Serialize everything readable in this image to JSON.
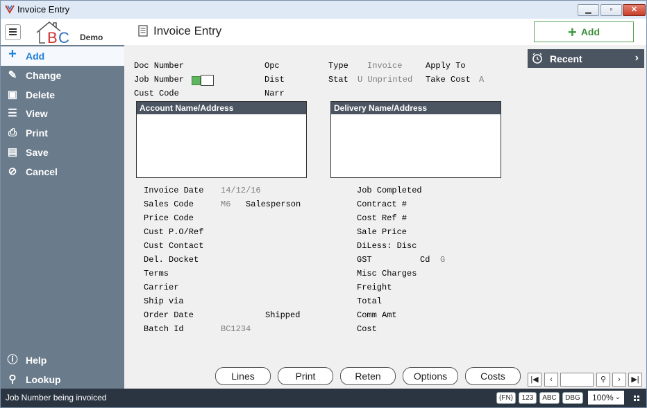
{
  "window": {
    "title": "Invoice Entry",
    "minimize_icon": "minimize-icon",
    "maximize_icon": "maximize-icon",
    "close_icon": "close-icon"
  },
  "header": {
    "logo_text": "BC",
    "logo_sub": "Demo",
    "page_title": "Invoice Entry",
    "add_label": "Add"
  },
  "sidebar": {
    "items": [
      {
        "label": "Add",
        "icon": "plus-icon"
      },
      {
        "label": "Change",
        "icon": "pencil-icon"
      },
      {
        "label": "Delete",
        "icon": "trash-icon"
      },
      {
        "label": "View",
        "icon": "list-icon"
      },
      {
        "label": "Print",
        "icon": "printer-icon"
      },
      {
        "label": "Save",
        "icon": "floppy-icon"
      },
      {
        "label": "Cancel",
        "icon": "cancel-icon"
      }
    ],
    "bottom_items": [
      {
        "label": "Help",
        "icon": "info-icon"
      },
      {
        "label": "Lookup",
        "icon": "search-icon"
      }
    ]
  },
  "recent": {
    "label": "Recent"
  },
  "form": {
    "doc_number": "Doc Number",
    "job_number": "Job Number",
    "cust_code": "Cust Code",
    "opc": "Opc",
    "dist": "Dist",
    "narr": "Narr",
    "type": "Type",
    "type_value": "Invoice",
    "stat": "Stat",
    "stat_value": "U Unprinted",
    "apply_to": "Apply To",
    "take_cost": "Take Cost",
    "take_cost_value": "A",
    "account_box": "Account Name/Address",
    "delivery_box": "Delivery Name/Address",
    "left_fields": [
      {
        "label": "Invoice Date",
        "value": "14/12/16"
      },
      {
        "label": "Sales Code",
        "value": "M6"
      },
      {
        "label": "Price Code",
        "value": ""
      },
      {
        "label": "Cust P.O/Ref",
        "value": ""
      },
      {
        "label": "Cust Contact",
        "value": ""
      },
      {
        "label": "Del. Docket",
        "value": ""
      },
      {
        "label": "Terms",
        "value": ""
      },
      {
        "label": "Carrier",
        "value": ""
      },
      {
        "label": "Ship via",
        "value": ""
      },
      {
        "label": "Order Date",
        "value": ""
      },
      {
        "label": "Batch Id",
        "value": "BC1234"
      }
    ],
    "salesperson": "Salesperson",
    "shipped": "Shipped",
    "right_fields": [
      "Job Completed",
      "Contract #",
      "Cost Ref #",
      "Sale Price",
      "DiLess: Disc",
      "GST",
      "Misc Charges",
      "Freight",
      "Total",
      "Comm Amt",
      "Cost"
    ],
    "cd_label": "Cd",
    "cd_value": "G"
  },
  "buttons": {
    "lines": "Lines",
    "print": "Print",
    "reten": "Reten",
    "options": "Options",
    "costs": "Costs"
  },
  "status": {
    "message": "Job Number being invoiced",
    "tags": [
      "(FN)",
      "123",
      "ABC",
      "DBG"
    ],
    "zoom": "100%"
  }
}
